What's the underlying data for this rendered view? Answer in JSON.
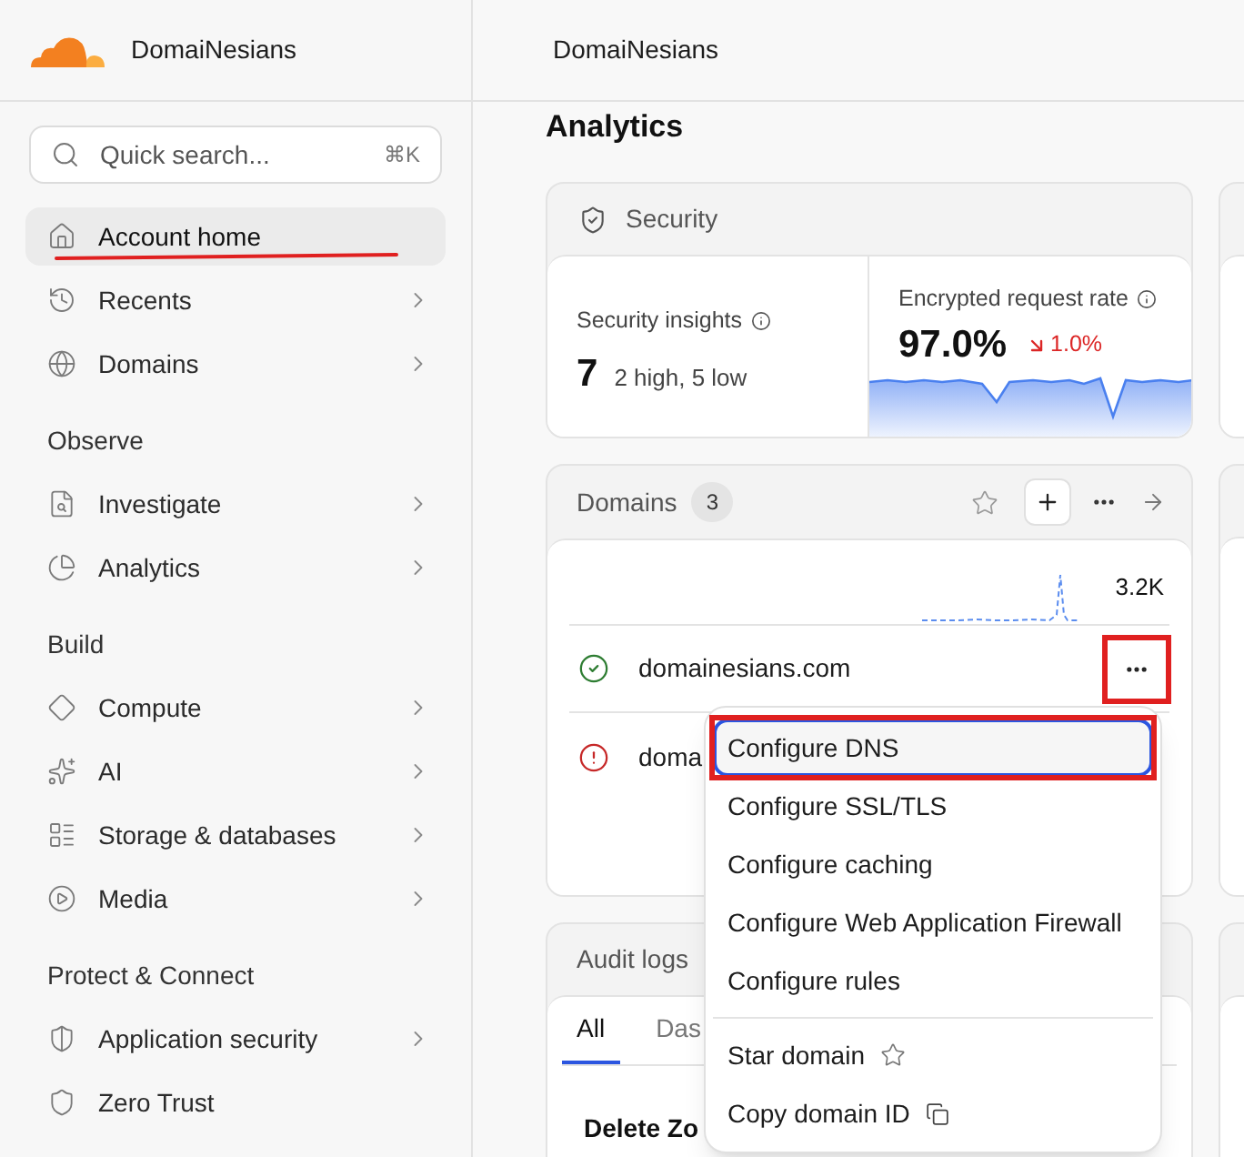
{
  "sidebar": {
    "account_name": "DomaiNesians",
    "search": {
      "placeholder": "Quick search...",
      "shortcut": "⌘K"
    },
    "groups": [
      {
        "items": [
          {
            "label": "Account home",
            "selected": true,
            "expandable": false,
            "annotated": true
          },
          {
            "label": "Recents",
            "selected": false,
            "expandable": true,
            "annotated": false
          },
          {
            "label": "Domains",
            "selected": false,
            "expandable": true,
            "annotated": false
          }
        ]
      },
      {
        "heading": "Observe",
        "items": [
          {
            "label": "Investigate",
            "selected": false,
            "expandable": true,
            "annotated": false
          },
          {
            "label": "Analytics",
            "selected": false,
            "expandable": true,
            "annotated": false
          }
        ]
      },
      {
        "heading": "Build",
        "items": [
          {
            "label": "Compute",
            "selected": false,
            "expandable": true,
            "annotated": false
          },
          {
            "label": "AI",
            "selected": false,
            "expandable": true,
            "annotated": false
          },
          {
            "label": "Storage & databases",
            "selected": false,
            "expandable": true,
            "annotated": false
          },
          {
            "label": "Media",
            "selected": false,
            "expandable": true,
            "annotated": false
          }
        ]
      },
      {
        "heading": "Protect & Connect",
        "items": [
          {
            "label": "Application security",
            "selected": false,
            "expandable": true,
            "annotated": false
          },
          {
            "label": "Zero Trust",
            "selected": false,
            "expandable": false,
            "annotated": false
          }
        ]
      }
    ]
  },
  "header": {
    "title": "DomaiNesians"
  },
  "analytics": {
    "title": "Analytics",
    "security_card": {
      "title": "Security",
      "insights": {
        "label": "Security insights",
        "value": "7",
        "detail": "2 high, 5 low"
      },
      "encrypted_rate": {
        "label": "Encrypted request rate",
        "value": "97.0%",
        "change": "1.0%",
        "falling": true
      }
    },
    "domains_card": {
      "title": "Domains",
      "count": "3",
      "peak_label": "3.2K",
      "rows": [
        {
          "name": "domainesians.com",
          "kind": "active",
          "menu_open": true,
          "annotated": true
        },
        {
          "name": "doma",
          "kind": "error",
          "menu_open": false,
          "annotated": false
        }
      ]
    },
    "domain_menu": {
      "groups": [
        {
          "items": [
            {
              "label": "Configure DNS",
              "selected": true,
              "annotated": true
            },
            {
              "label": "Configure SSL/TLS",
              "selected": false,
              "annotated": false
            },
            {
              "label": "Configure caching",
              "selected": false,
              "annotated": false
            },
            {
              "label": "Configure Web Application Firewall",
              "selected": false,
              "annotated": false
            },
            {
              "label": "Configure rules",
              "selected": false,
              "annotated": false
            }
          ]
        },
        {
          "items": [
            {
              "label": "Star domain",
              "kind": "star",
              "selected": false,
              "annotated": false
            },
            {
              "label": "Copy domain ID",
              "kind": "copy",
              "selected": false,
              "annotated": false
            }
          ]
        }
      ]
    },
    "audit_card": {
      "title": "Audit logs",
      "tabs": [
        {
          "label": "All",
          "selected": true
        },
        {
          "label": "Das",
          "selected": false
        }
      ],
      "first_entry": "Delete Zo"
    }
  }
}
